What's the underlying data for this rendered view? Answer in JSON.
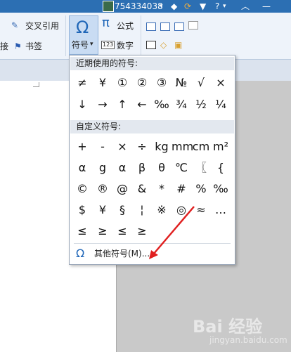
{
  "titlebar": {
    "username": "754334038",
    "caret": "▾",
    "help": "?"
  },
  "ribbon": {
    "cross_ref_label": "交叉引用",
    "left_partial_label": "接",
    "bookmark_label": "书签",
    "symbol_button_label": "符号",
    "symbol_caret": "▾",
    "formula_label": "公式",
    "number_label": "数字",
    "pi_glyph": "π",
    "number_icon_text": "123",
    "omega_glyph": "Ω"
  },
  "symbol_menu": {
    "recent_title": "近期使用的符号:",
    "recent_symbols": [
      "≠",
      "¥",
      "①",
      "②",
      "③",
      "№",
      "√",
      "×",
      "↓",
      "→",
      "↑",
      "←",
      "‰",
      "¾",
      "½",
      "¼"
    ],
    "custom_title": "自定义符号:",
    "custom_symbols": [
      "+",
      "-",
      "×",
      "÷",
      "kg",
      "mm",
      "cm",
      "m²",
      "α",
      "g",
      "α",
      "β",
      "θ",
      "℃",
      "〖",
      "{",
      "©",
      "®",
      "@",
      "&",
      "*",
      "#",
      "%",
      "‰",
      "$",
      "¥",
      "§",
      "¦",
      "※",
      "◎",
      "≈",
      "…",
      "≤",
      "≥",
      "≤",
      "≥"
    ],
    "more_symbols_label": "其他符号(M)...",
    "more_omega": "Ω"
  },
  "watermark": {
    "brand": "Bai 经验",
    "url": "jingyan.baidu.com"
  },
  "colors": {
    "accent": "#1f66b8",
    "arrow": "#e02020",
    "titlebar": "#2c6fb3"
  }
}
